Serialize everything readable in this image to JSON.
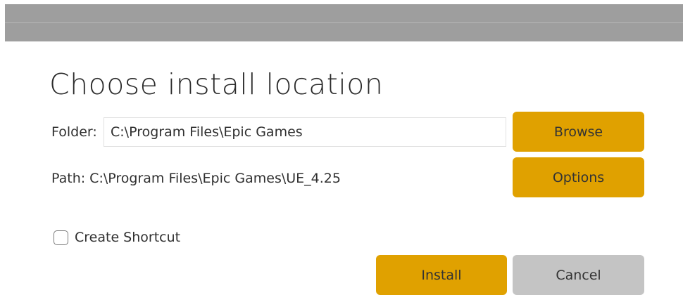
{
  "dialog": {
    "title": "Choose install location",
    "folder_label": "Folder:",
    "folder_value": "C:\\Program Files\\Epic Games",
    "path_text": "Path: C:\\Program Files\\Epic Games\\UE_4.25",
    "browse_label": "Browse",
    "options_label": "Options",
    "shortcut_label": "Create Shortcut",
    "shortcut_checked": false,
    "install_label": "Install",
    "cancel_label": "Cancel"
  },
  "colors": {
    "accent": "#e0a100",
    "secondary_button": "#c4c4c4",
    "titlebar": "#9e9e9e"
  }
}
